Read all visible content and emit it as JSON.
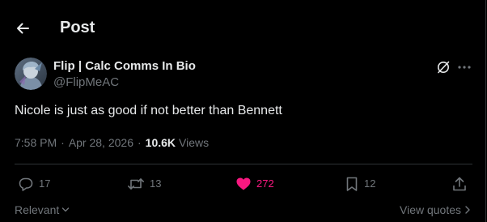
{
  "header": {
    "title": "Post"
  },
  "post": {
    "author": {
      "display_name": "Flip | Calc Comms In Bio",
      "handle": "@FlipMeAC"
    },
    "text": "Nicole is just as good if not better than Bennett",
    "time": "7:58 PM",
    "separator": "·",
    "date": "Apr 28, 2026",
    "views_count": "10.6K",
    "views_label": "Views"
  },
  "actions": {
    "replies": "17",
    "reposts": "13",
    "likes": "272",
    "bookmarks": "12"
  },
  "footer": {
    "sort_label": "Relevant",
    "view_quotes_label": "View quotes"
  },
  "icons": {
    "back": "arrow-left-icon",
    "grok": "grok-icon",
    "more": "more-horizontal-icon",
    "reply": "reply-icon",
    "repost": "repost-icon",
    "like": "heart-icon",
    "bookmark": "bookmark-icon",
    "share": "share-icon"
  },
  "colors": {
    "background": "#000000",
    "text_primary": "#e7e9ea",
    "text_secondary": "#71767b",
    "like_active": "#f91880",
    "divider": "#2f3336"
  }
}
